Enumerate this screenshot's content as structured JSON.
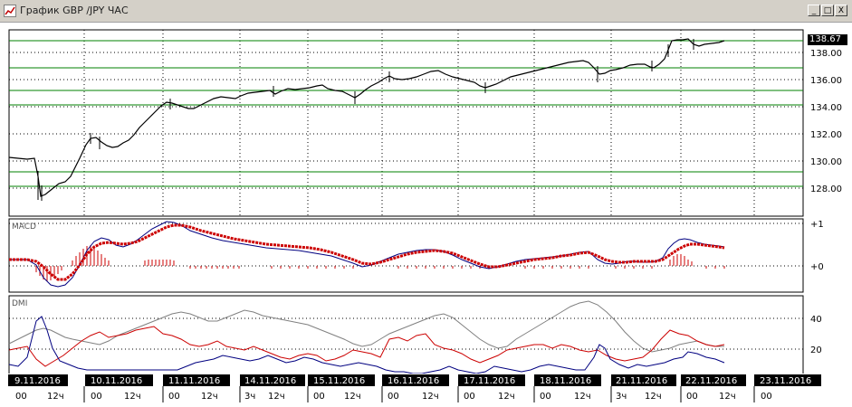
{
  "window": {
    "title": "График GBP /JPY  ЧАС",
    "buttons": [
      "_",
      "□",
      "X"
    ]
  },
  "price_panel": {
    "current_price": "138.67",
    "levels": [
      "138.00",
      "136.00",
      "134.00",
      "132.00",
      "130.00",
      "128.00"
    ]
  },
  "macd_panel": {
    "label": "MACD",
    "scale": [
      "+1",
      "+0"
    ]
  },
  "dmi_panel": {
    "label": "DMI",
    "scale": [
      "40",
      "20"
    ]
  },
  "time_axis": {
    "dates": [
      "9.11.2016",
      "10.11.2016",
      "11.11.2016",
      "14.11.2016",
      "15.11.2016",
      "16.11.2016",
      "17.11.2016",
      "18.11.2016",
      "21.11.2016",
      "22.11.2016",
      "23.11.2016"
    ],
    "hours": [
      "00",
      "12ч",
      "00",
      "12ч",
      "00",
      "12ч",
      "3ч",
      "12ч",
      "00",
      "12ч",
      "00",
      "12ч",
      "00",
      "12ч",
      "00",
      "12ч",
      "3ч",
      "12ч",
      "00",
      "12ч",
      "00"
    ]
  },
  "colors": {
    "candles": "#000000",
    "level_lines": "#008000",
    "grid": "#000000",
    "macd_line": "#000080",
    "macd_signal": "#cc0000",
    "macd_hist": "#cc0000",
    "dmi_adx": "#808080",
    "dmi_plus": "#cc0000",
    "dmi_minus": "#000080",
    "date_bar": "#000000"
  }
}
